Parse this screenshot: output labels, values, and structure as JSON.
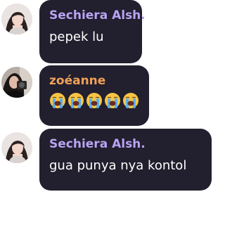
{
  "colors": {
    "bubble_background": "#221f2e",
    "message_text": "#ffffff"
  },
  "messages": [
    {
      "author": "Sechiera Alsh.",
      "author_color": "#b9a3f2",
      "text": "pepek lu",
      "avatar_icon": "profile-photo"
    },
    {
      "author": "zoéanne",
      "author_color": "#f0a15a",
      "emoji": [
        "😭",
        "😭",
        "😭",
        "😭",
        "😭"
      ],
      "emoji_icon": "loudly-crying-face",
      "avatar_icon": "profile-photo"
    },
    {
      "author": "Sechiera Alsh.",
      "author_color": "#b9a3f2",
      "text": "gua punya nya kontol",
      "avatar_icon": "profile-photo"
    }
  ]
}
